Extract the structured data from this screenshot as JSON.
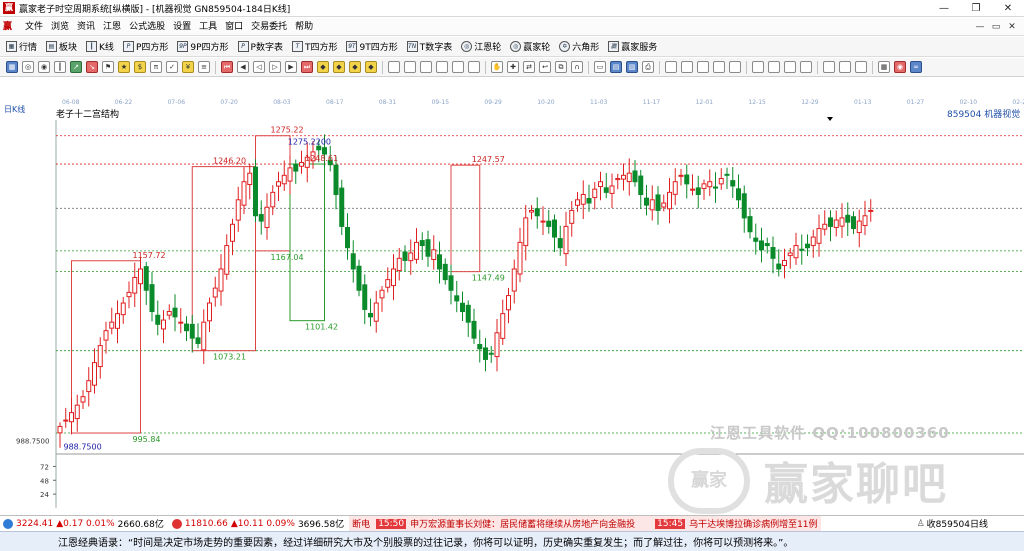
{
  "window": {
    "title": "赢家老子时空周期系统[纵横版] - [机器视觉 GN859504-184日K线]",
    "controls": [
      "—",
      "❐",
      "✕"
    ]
  },
  "menu": {
    "items": [
      "文件",
      "浏览",
      "资讯",
      "江恩",
      "公式选股",
      "设置",
      "工具",
      "窗口",
      "交易委托",
      "帮助"
    ],
    "right": [
      "—",
      "▭",
      "✕"
    ]
  },
  "toolbar1": {
    "items": [
      {
        "icon": "grid-icon",
        "label": "行情"
      },
      {
        "icon": "blocks-icon",
        "label": "板块"
      },
      {
        "icon": "candle-icon",
        "label": "K线"
      },
      {
        "icon": "p-square-icon",
        "label": "P四方形"
      },
      {
        "icon": "9p-square-icon",
        "label": "9P四方形"
      },
      {
        "icon": "p-table-icon",
        "label": "P数字表"
      },
      {
        "icon": "t-square-icon",
        "label": "T四方形"
      },
      {
        "icon": "9t-square-icon",
        "label": "9T四方形"
      },
      {
        "icon": "t-table-icon",
        "label": "T数字表"
      },
      {
        "icon": "gann-wheel-icon",
        "label": "江恩轮"
      },
      {
        "icon": "winner-wheel-icon",
        "label": "赢家轮"
      },
      {
        "icon": "hexagon-icon",
        "label": "六角形"
      },
      {
        "icon": "service-icon",
        "label": "赢家服务"
      }
    ]
  },
  "toolbar2": {
    "icons": [
      "grid",
      "ring",
      "ring2",
      "bar",
      "line-up",
      "line-down",
      "flag",
      "star",
      "dollar",
      "pi",
      "mark",
      "yen",
      "bars",
      "sep",
      "first",
      "prev",
      "left",
      "right",
      "next",
      "last",
      "diamond",
      "diamond",
      "diamond",
      "diamond",
      "sep",
      "d1",
      "d2",
      "d3",
      "d4",
      "d5",
      "d6",
      "sep",
      "hand",
      "plus",
      "arrows",
      "hook",
      "copy",
      "magnet",
      "sep",
      "ruler",
      "table",
      "doc",
      "print",
      "sep",
      "m1",
      "m2",
      "m3",
      "m4",
      "m5",
      "sep",
      "c1",
      "c2",
      "c3",
      "c4",
      "sep",
      "c5",
      "c6",
      "c7",
      "sep",
      "calc",
      "close",
      "infinity"
    ],
    "colors": [
      "b",
      "",
      "",
      "",
      "g",
      "r",
      "",
      "y",
      "y",
      "",
      "",
      "y",
      "",
      "",
      "r",
      "",
      "",
      "",
      "",
      "r",
      "y",
      "y",
      "y",
      "y",
      "",
      "",
      "",
      "",
      "",
      "",
      "",
      "",
      "",
      "",
      "",
      "",
      "",
      "",
      "",
      "",
      "b",
      "b",
      "",
      "",
      "",
      "",
      "",
      "",
      "",
      "",
      "",
      "",
      "",
      "",
      "",
      "",
      "",
      "",
      "",
      "",
      "r",
      "b"
    ]
  },
  "date_axis": [
    "06-08",
    "06-22",
    "07-06",
    "07-20",
    "08-03",
    "08-17",
    "08-31",
    "09-15",
    "09-29",
    "10-20",
    "11-03",
    "11-17",
    "12-01",
    "12-15",
    "12-29",
    "01-13",
    "01-27",
    "02-10",
    "02-24"
  ],
  "chart_header": {
    "period": "日K线",
    "study": "老子十二宫结构",
    "code": "859504",
    "name": "机器视觉"
  },
  "chart_data": {
    "type": "candlestick",
    "ylim": [
      978,
      1290
    ],
    "price_axis_label": "988.7500",
    "volume_axis": {
      "ylim": [
        0,
        90
      ],
      "ticks": [
        72,
        48,
        24
      ]
    },
    "levels": [
      {
        "value": 1275.22,
        "color": "#d22"
      },
      {
        "value": 1248.61,
        "color": "#d22"
      },
      {
        "value": 1207,
        "color": "#777"
      },
      {
        "value": 1167.04,
        "color": "#2a9a2a"
      },
      {
        "value": 1147.49,
        "color": "#2a9a2a"
      },
      {
        "value": 1073.21,
        "color": "#2a9a2a"
      },
      {
        "value": 995.84,
        "color": "#2a9a2a"
      }
    ],
    "boxes": [
      {
        "i0": 2,
        "i1": 14,
        "high": 1157.72,
        "low": 995.84,
        "color": "#d44"
      },
      {
        "i0": 23,
        "i1": 34,
        "high": 1246.2,
        "low": 1073.21,
        "color": "#d44"
      },
      {
        "i0": 34,
        "i1": 40,
        "high": 1275.22,
        "low": 1167.04,
        "color": "#d44"
      },
      {
        "i0": 40,
        "i1": 46,
        "high": 1248.61,
        "low": 1101.42,
        "color": "#2a9a2a"
      },
      {
        "i0": 68,
        "i1": 73,
        "high": 1247.57,
        "low": 1147.49,
        "color": "#d44"
      }
    ],
    "annotations": [
      {
        "i": 14,
        "value": 1157.72,
        "text": "1157.72",
        "color": "#c22",
        "pos": "above"
      },
      {
        "i": 2,
        "value": 988.75,
        "text": "988.7500",
        "color": "#22a",
        "pos": "below"
      },
      {
        "i": 14,
        "value": 995.84,
        "text": "995.84",
        "color": "#2a9a2a",
        "pos": "below"
      },
      {
        "i": 28,
        "value": 1246.2,
        "text": "1246.20",
        "color": "#c22",
        "pos": "above"
      },
      {
        "i": 28,
        "value": 1073.21,
        "text": "1073.21",
        "color": "#2a9a2a",
        "pos": "below"
      },
      {
        "i": 38,
        "value": 1275.22,
        "text": "1275.22",
        "color": "#c22",
        "pos": "above"
      },
      {
        "i": 41,
        "value": 1275.22,
        "text": "1275.2200",
        "color": "#22a",
        "pos": "below"
      },
      {
        "i": 44,
        "value": 1248.61,
        "text": "1248.61",
        "color": "#c22",
        "pos": "above"
      },
      {
        "i": 38,
        "value": 1167.04,
        "text": "1167.04",
        "color": "#2a9a2a",
        "pos": "below"
      },
      {
        "i": 44,
        "value": 1101.42,
        "text": "1101.42",
        "color": "#2a9a2a",
        "pos": "below"
      },
      {
        "i": 73,
        "value": 1247.57,
        "text": "1247.57",
        "color": "#c22",
        "pos": "above"
      },
      {
        "i": 73,
        "value": 1147.49,
        "text": "1147.49",
        "color": "#2a9a2a",
        "pos": "below"
      }
    ],
    "close": [
      1002,
      1008,
      1015,
      1022,
      1030,
      1045,
      1062,
      1078,
      1092,
      1100,
      1108,
      1118,
      1128,
      1142,
      1150,
      1130,
      1110,
      1098,
      1102,
      1110,
      1105,
      1100,
      1092,
      1085,
      1080,
      1100,
      1118,
      1132,
      1150,
      1172,
      1192,
      1215,
      1232,
      1240,
      1200,
      1195,
      1208,
      1222,
      1232,
      1238,
      1245,
      1242,
      1250,
      1255,
      1260,
      1262,
      1258,
      1248,
      1220,
      1190,
      1170,
      1150,
      1130,
      1112,
      1105,
      1118,
      1130,
      1140,
      1150,
      1160,
      1158,
      1165,
      1175,
      1172,
      1162,
      1168,
      1150,
      1140,
      1130,
      1120,
      1110,
      1100,
      1085,
      1075,
      1065,
      1070,
      1090,
      1108,
      1125,
      1150,
      1175,
      1198,
      1205,
      1200,
      1195,
      1190,
      1180,
      1170,
      1190,
      1205,
      1215,
      1220,
      1212,
      1225,
      1232,
      1222,
      1228,
      1235,
      1238,
      1240,
      1232,
      1220,
      1210,
      1215,
      1205,
      1212,
      1222,
      1232,
      1238,
      1230,
      1225,
      1220,
      1230,
      1232,
      1226,
      1235,
      1238,
      1228,
      1215,
      1198,
      1185,
      1176,
      1168,
      1172,
      1160,
      1150,
      1158,
      1165,
      1172,
      1168,
      1170,
      1180,
      1188,
      1192,
      1190,
      1196,
      1198,
      1194,
      1188,
      1195,
      1200,
      1205
    ],
    "volume_note": "volume panel rendered as thin bars"
  },
  "watermark": {
    "line1": "江恩工具软件  QQ:100800360",
    "logo": "赢家",
    "line2": "赢家聊吧"
  },
  "status": {
    "sh_index": "3224.41",
    "sh_change": "▲0.17 0.01%",
    "sh_amount": "2660.68亿",
    "sz_index": "11810.66",
    "sz_change": "▲10.11 0.09%",
    "sz_amount": "3696.58亿",
    "ticker_prefix": "断电",
    "ticker_time1": "15:50",
    "ticker_text1": "申万宏源董事长刘健：居民储蓄将继续从房地产向金融投",
    "ticker_time2": "15:45",
    "ticker_text2": "乌干达埃博拉确诊病例增至11例",
    "right_text": "收859504日线"
  },
  "quote": {
    "text": "江恩经典语录：“时间是决定市场走势的重要因素，经过详细研究大市及个别股票的过往记录，你将可以证明，历史确实重复发生；而了解过往，你将可以预测将来。”。"
  }
}
